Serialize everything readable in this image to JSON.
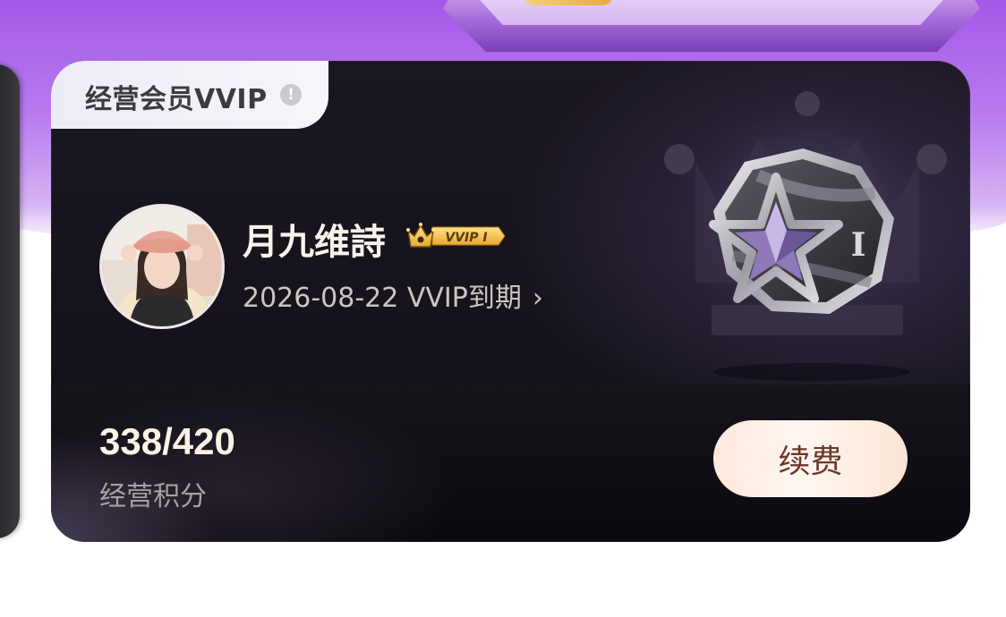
{
  "card": {
    "tag_label": "经营会员VVIP",
    "info_icon_glyph": "!",
    "user_name": "月九维詩",
    "vip_badge_text": "VVIP I",
    "expiry_text": "2026-08-22 VVIP到期",
    "arrow_glyph": "›",
    "score_value": "338/420",
    "score_label": "经营积分",
    "renew_button_label": "续费",
    "medal_level": "I"
  },
  "icons": {
    "info": "info-icon",
    "crown": "crown-icon",
    "chevron": "chevron-right-icon",
    "medal": "star-medal-icon"
  },
  "colors": {
    "card_background": "#15121b",
    "tag_background": "#f1f0f8",
    "renew_button": "#fde8dc",
    "badge_gold": "#f3c14b",
    "header_purple": "#a35ae8"
  }
}
